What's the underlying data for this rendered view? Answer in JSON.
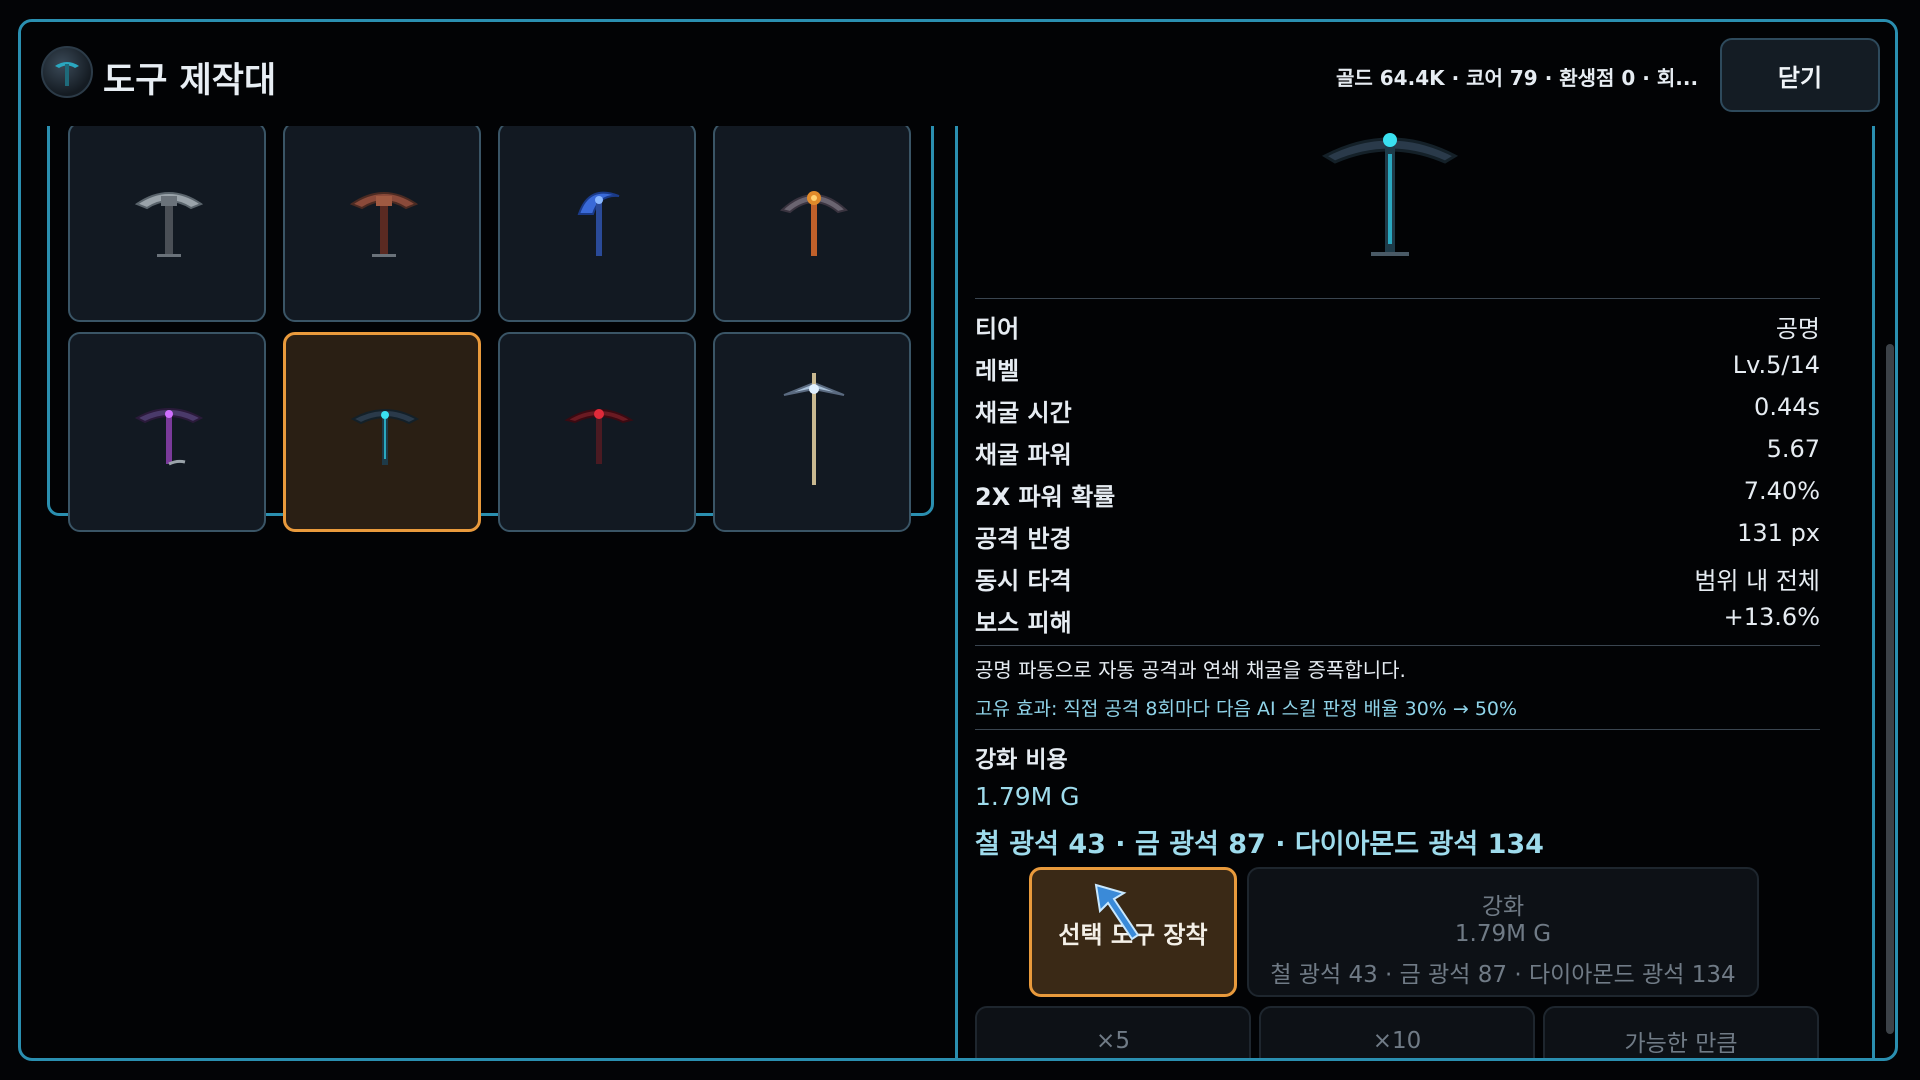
{
  "header": {
    "title": "도구 제작대",
    "resources": "골드 64.4K · 코어 79 · 환생점 0 · 회...",
    "close_label": "닫기"
  },
  "grid": {
    "tiles": [
      {
        "icon": "steel-pickaxe-icon",
        "color": "#9aa3aa"
      },
      {
        "icon": "bronze-pickaxe-icon",
        "color": "#8a4a3a"
      },
      {
        "icon": "sapphire-pickaxe-icon",
        "color": "#3a6ad8"
      },
      {
        "icon": "flame-pickaxe-icon",
        "color": "#e08a2a"
      },
      {
        "icon": "amethyst-pickaxe-icon",
        "color": "#7a3a9a"
      },
      {
        "icon": "resonance-pickaxe-icon",
        "color": "#2aa8c0",
        "selected": true
      },
      {
        "icon": "crimson-pickaxe-icon",
        "color": "#b02a3a"
      },
      {
        "icon": "crystal-staff-pickaxe-icon",
        "color": "#a8c0d8"
      }
    ]
  },
  "detail": {
    "preview_icon": "resonance-pickaxe-icon",
    "stats": [
      {
        "label": "티어",
        "value": "공명"
      },
      {
        "label": "레벨",
        "value": "Lv.5/14"
      },
      {
        "label": "채굴 시간",
        "value": "0.44s"
      },
      {
        "label": "채굴 파워",
        "value": "5.67"
      },
      {
        "label": "2X 파워 확률",
        "value": "7.40%"
      },
      {
        "label": "공격 반경",
        "value": "131 px"
      },
      {
        "label": "동시 타격",
        "value": "범위 내 전체"
      },
      {
        "label": "보스 피해",
        "value": "+13.6%"
      }
    ],
    "description": "공명 파동으로 자동 공격과 연쇄 채굴을 증폭합니다.",
    "unique_effect": "고유 효과: 직접 공격 8회마다 다음 AI 스킬 판정 배율 30% → 50%",
    "cost_label": "강화 비용",
    "cost_gold": "1.79M G",
    "cost_ores": "철 광석 43 · 금 광석 87 · 다이아몬드 광석 134",
    "equip_label": "선택 도구 장착",
    "upgrade": {
      "label": "강화",
      "gold": "1.79M G",
      "ores": "철 광석 43 · 금 광석 87 · 다이아몬드 광석 134"
    },
    "multi_buttons": [
      "×5",
      "×10",
      "가능한 만큼"
    ]
  },
  "colors": {
    "accent": "#2a8fb0",
    "selected": "#e99a3c",
    "cost_text": "#9edbec"
  }
}
